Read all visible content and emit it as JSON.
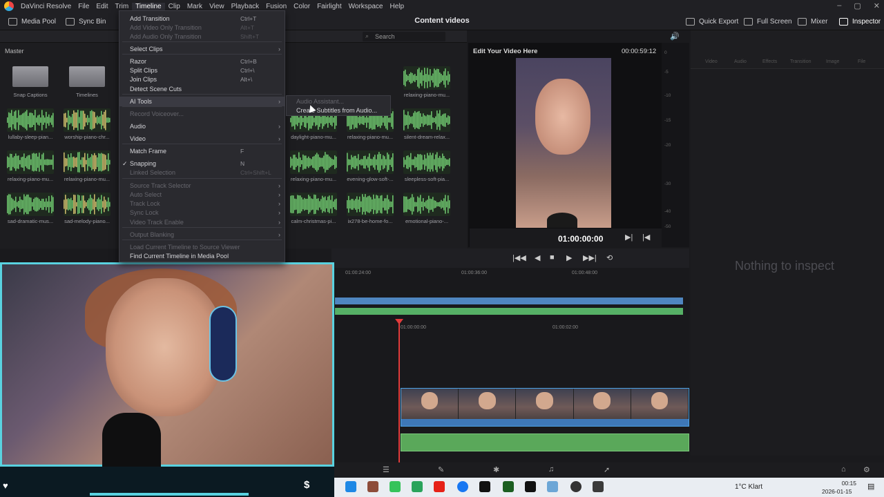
{
  "app_menu": [
    "DaVinci Resolve",
    "File",
    "Edit",
    "Trim",
    "Timeline",
    "Clip",
    "Mark",
    "View",
    "Playback",
    "Fusion",
    "Color",
    "Fairlight",
    "Workspace",
    "Help"
  ],
  "toolbar": {
    "media_pool": "Media Pool",
    "sync_bin": "Sync Bin",
    "project_title": "Content videos",
    "quick_export": "Quick Export",
    "full_screen": "Full Screen",
    "mixer": "Mixer",
    "inspector": "Inspector"
  },
  "media_pool": {
    "bin_name": "Master",
    "search_placeholder": "Search",
    "clips": [
      "Snap Captions",
      "Timelines",
      "relaxing-piano-mu...",
      "lullaby-sleep-pian...",
      "worship-piano-chr...",
      "daylight-piano-mu...",
      "relaxing-piano-mu...",
      "silent-dream-relax...",
      "relaxing-piano-mu...",
      "relaxing-piano-mu...",
      "relaxing-piano-mu...",
      "evening-glow-soft-...",
      "sleepless-soft-pia...",
      "sad-dramatic-mus...",
      "sad-melody-piano...",
      "calm-christmas-pi...",
      "ix278-be-home-fo...",
      "emotional-piano-..."
    ]
  },
  "viewer": {
    "timeline_name": "Edit Your Video Here",
    "duration": "00:00:59:12",
    "timecode": "01:00:00:00"
  },
  "meter_ticks": [
    "0",
    "-5",
    "-10",
    "-15",
    "-20",
    "-30",
    "-40",
    "-50"
  ],
  "inspector": {
    "tabs": [
      "Video",
      "Audio",
      "Effects",
      "Transition",
      "Image",
      "File"
    ],
    "empty_text": "Nothing to inspect"
  },
  "timeline": {
    "ruler_upper": [
      "01:00:24:00",
      "01:00:36:00",
      "01:00:48:00"
    ],
    "ruler_lower": [
      "01:00:00:00",
      "01:00:02:00"
    ]
  },
  "timeline_menu": {
    "items": [
      {
        "label": "Add Transition",
        "shortcut": "Ctrl+T",
        "enabled": true
      },
      {
        "label": "Add Video Only Transition",
        "shortcut": "Alt+T",
        "enabled": false
      },
      {
        "label": "Add Audio Only Transition",
        "shortcut": "Shift+T",
        "enabled": false
      },
      {
        "label": "Select Clips",
        "shortcut": "",
        "enabled": true,
        "submenu": true
      },
      {
        "label": "Razor",
        "shortcut": "Ctrl+B",
        "enabled": true
      },
      {
        "label": "Split Clips",
        "shortcut": "Ctrl+\\",
        "enabled": true
      },
      {
        "label": "Join Clips",
        "shortcut": "Alt+\\",
        "enabled": true
      },
      {
        "label": "Detect Scene Cuts",
        "shortcut": "",
        "enabled": true
      },
      {
        "label": "AI Tools",
        "shortcut": "",
        "enabled": true,
        "submenu": true
      },
      {
        "label": "Record Voiceover...",
        "shortcut": "",
        "enabled": false
      },
      {
        "label": "Audio",
        "shortcut": "",
        "enabled": true,
        "submenu": true
      },
      {
        "label": "Video",
        "shortcut": "",
        "enabled": true,
        "submenu": true
      },
      {
        "label": "Match Frame",
        "shortcut": "F",
        "enabled": true
      },
      {
        "label": "Snapping",
        "shortcut": "N",
        "enabled": true,
        "checked": true
      },
      {
        "label": "Linked Selection",
        "shortcut": "Ctrl+Shift+L",
        "enabled": false
      },
      {
        "label": "Source Track Selector",
        "shortcut": "",
        "enabled": false,
        "submenu": true
      },
      {
        "label": "Auto Select",
        "shortcut": "",
        "enabled": false,
        "submenu": true
      },
      {
        "label": "Track Lock",
        "shortcut": "",
        "enabled": false,
        "submenu": true
      },
      {
        "label": "Sync Lock",
        "shortcut": "",
        "enabled": false,
        "submenu": true
      },
      {
        "label": "Video Track Enable",
        "shortcut": "",
        "enabled": false,
        "submenu": true
      },
      {
        "label": "Output Blanking",
        "shortcut": "",
        "enabled": false,
        "submenu": true
      },
      {
        "label": "Load Current Timeline to Source Viewer",
        "shortcut": "",
        "enabled": false
      },
      {
        "label": "Find Current Timeline in Media Pool",
        "shortcut": "",
        "enabled": true
      }
    ],
    "ai_submenu": [
      {
        "label": "Audio Assistant...",
        "enabled": false
      },
      {
        "label": "Create Subtitles from Audio...",
        "enabled": true
      }
    ]
  },
  "taskbar": {
    "weather": "1°C  Klart",
    "time": "00:15",
    "date": "2026-01-15"
  },
  "colors": {
    "accent_cyan": "#59d2e0",
    "audio_green": "#56b066",
    "video_blue": "#4f86c0",
    "playhead_red": "#e23b3b"
  }
}
